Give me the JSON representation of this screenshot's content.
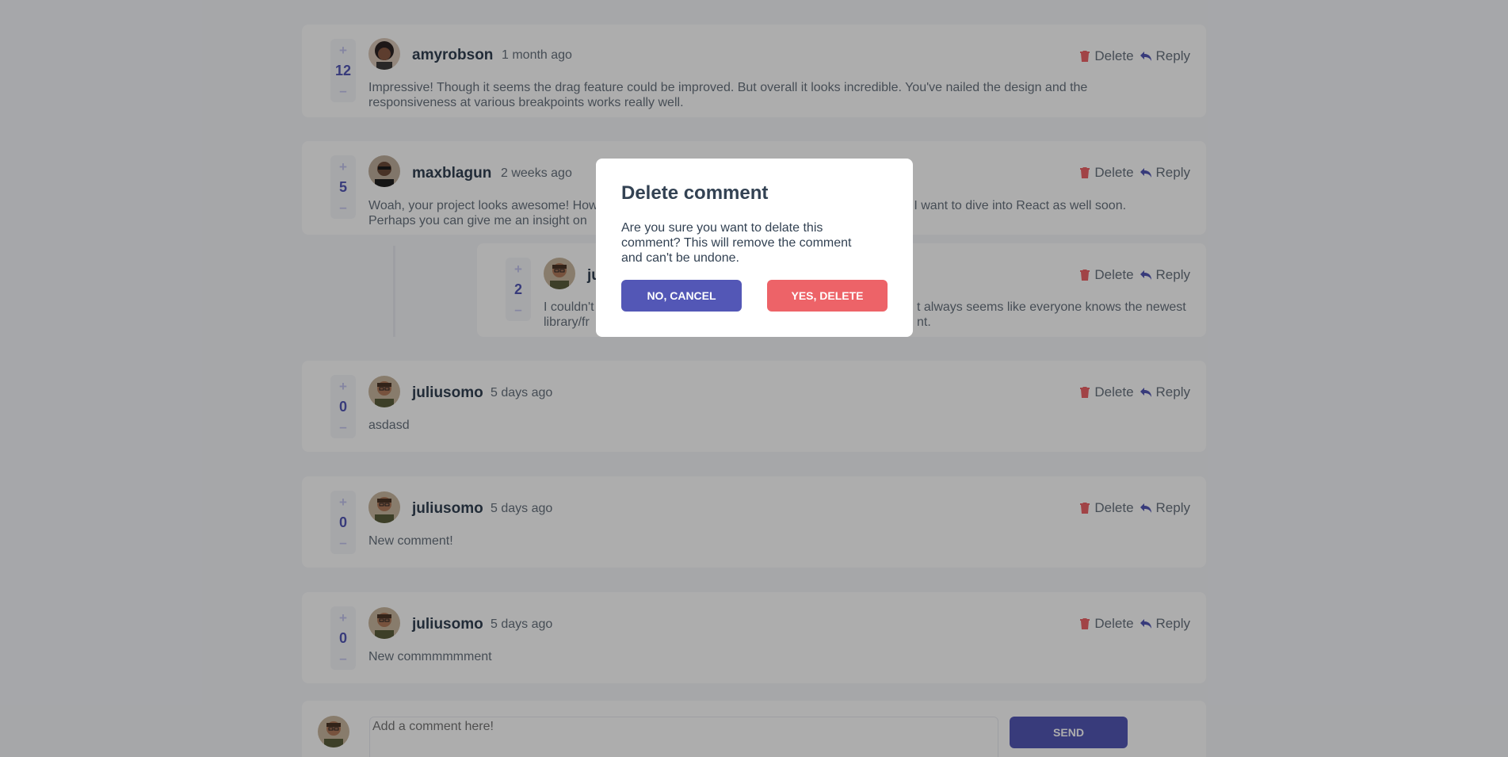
{
  "comments": [
    {
      "score": "12",
      "username": "amyrobson",
      "created": "1 month ago",
      "content_line1": "Impressive! Though it seems the drag feature could be improved. But overall it looks incredible. You've nailed the design and the",
      "content_line2": "responsiveness at various breakpoints works really well.",
      "avatar": "avatar-amyrobson"
    },
    {
      "score": "5",
      "username": "maxblagun",
      "created": "2 weeks ago",
      "content_line1": "Woah, your project looks awesome! How",
      "content_line1_tail": "nk I want to dive into React as well soon.",
      "content_line2": "Perhaps you can give me an insight on",
      "avatar": "avatar-maxblagun"
    },
    {
      "score": "2",
      "username": "ju",
      "created": "",
      "content_line1": "I couldn't",
      "content_line1_tail": "t always seems like everyone knows the newest",
      "content_line2": "library/fr",
      "content_line2_tail": "nt.",
      "avatar": "avatar-juliusomo"
    },
    {
      "score": "0",
      "username": "juliusomo",
      "created": "5 days ago",
      "content_line1": "asdasd",
      "avatar": "avatar-juliusomo"
    },
    {
      "score": "0",
      "username": "juliusomo",
      "created": "5 days ago",
      "content_line1": "New comment!",
      "avatar": "avatar-juliusomo"
    },
    {
      "score": "0",
      "username": "juliusomo",
      "created": "5 days ago",
      "content_line1": "New commmmmment",
      "avatar": "avatar-juliusomo"
    }
  ],
  "vote": {
    "plus": "+",
    "minus": "–"
  },
  "actions": {
    "delete": "Delete",
    "reply": "Reply"
  },
  "modal": {
    "title": "Delete comment",
    "text": "Are you sure you want to delate this comment? This will remove the comment and can't be undone.",
    "cancel": "NO, CANCEL",
    "confirm": "YES, DELETE"
  },
  "compose": {
    "placeholder": "Add a comment here!",
    "send": "SEND"
  },
  "colors": {
    "accent": "#5357b6",
    "danger": "#ed6368",
    "text_dark": "#334253",
    "text_muted": "#67727e",
    "background": "#f5f6fa"
  }
}
